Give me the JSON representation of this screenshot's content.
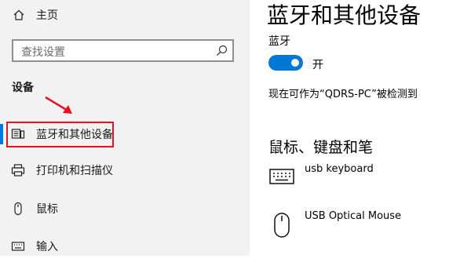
{
  "sidebar": {
    "home_label": "主页",
    "search_placeholder": "查找设置",
    "section_title": "设备",
    "items": [
      {
        "label": "蓝牙和其他设备",
        "icon": "devices-icon",
        "active": true
      },
      {
        "label": "打印机和扫描仪",
        "icon": "printer-icon"
      },
      {
        "label": "鼠标",
        "icon": "mouse-icon"
      },
      {
        "label": "输入",
        "icon": "keyboard-icon"
      }
    ]
  },
  "main": {
    "title": "蓝牙和其他设备",
    "bluetooth_label": "蓝牙",
    "toggle_state": "开",
    "discoverable_text": "现在可作为“QDRS-PC”被检测到",
    "subsection_title": "鼠标、键盘和笔",
    "devices": [
      {
        "name": "usb keyboard",
        "icon": "keyboard-icon"
      },
      {
        "name": "USB Optical Mouse",
        "icon": "mouse-icon"
      }
    ]
  },
  "colors": {
    "accent": "#0078d7",
    "annotation": "#e81123",
    "sidebar_bg": "#f2f2f2"
  }
}
